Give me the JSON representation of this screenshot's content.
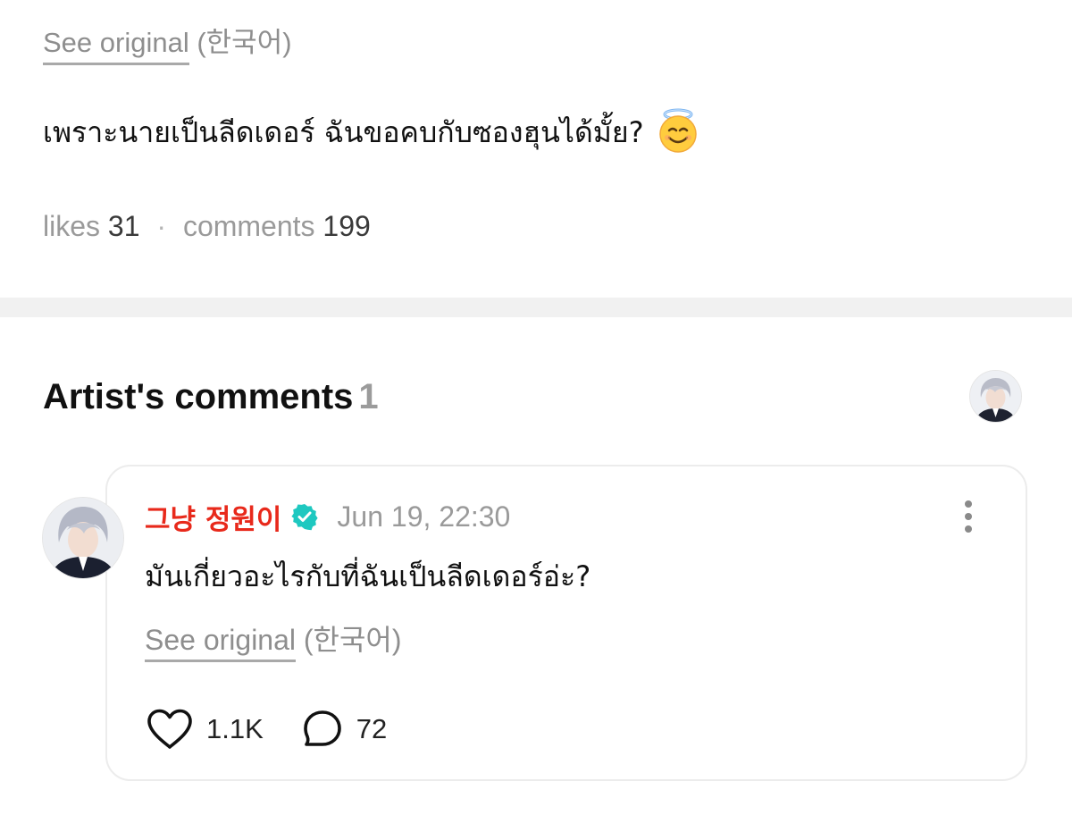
{
  "post": {
    "translation": {
      "see_original": "See original",
      "language": "(한국어)"
    },
    "body_text": "เพราะนายเป็นลีดเดอร์ ฉันขอคบกับซองฮุนได้มั้ย?",
    "emoji": "smiling-face-with-halo",
    "stats": {
      "likes_label": "likes",
      "likes_value": "31",
      "separator": "·",
      "comments_label": "comments",
      "comments_value": "199"
    }
  },
  "artist_comments": {
    "title": "Artist's comments",
    "count": "1",
    "comments": [
      {
        "author": "그냥 정원이",
        "verified": true,
        "timestamp": "Jun 19, 22:30",
        "text": "มันเกี่ยวอะไรกับที่ฉันเป็นลีดเดอร์อ่ะ?",
        "translation": {
          "see_original": "See original",
          "language": "(한국어)"
        },
        "likes": "1.1K",
        "replies": "72"
      }
    ]
  },
  "colors": {
    "author_name": "#e8291b",
    "verified_badge": "#1ec8c0",
    "muted_text": "#8e8e8e",
    "divider": "#f1f1f1"
  },
  "icons": {
    "verified": "verified-badge-icon",
    "more": "more-vertical-icon",
    "like": "heart-outline-icon",
    "reply": "speech-bubble-outline-icon"
  }
}
